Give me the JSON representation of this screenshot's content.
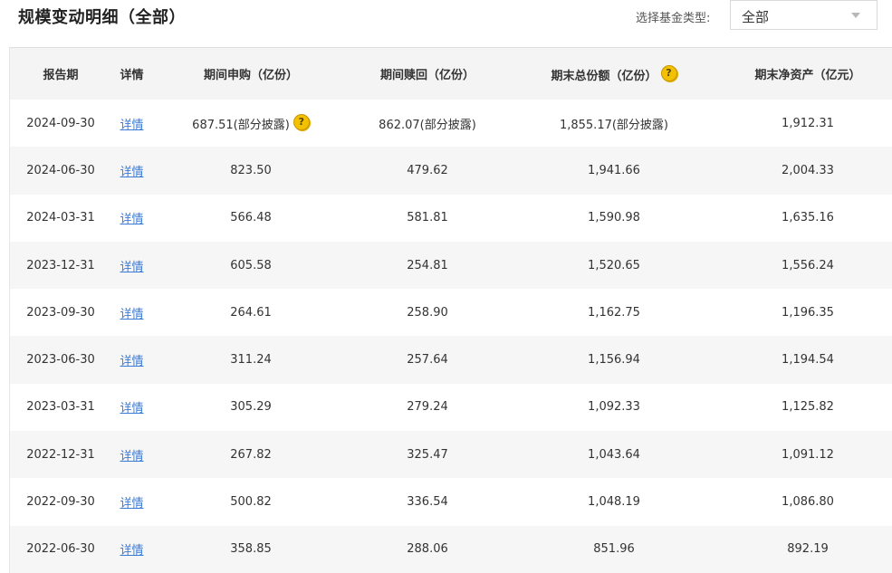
{
  "page": {
    "title": "规模变动明细（全部）"
  },
  "filter": {
    "label": "选择基金类型:",
    "selected": "全部"
  },
  "help_icon_glyph": "?",
  "table": {
    "headers": [
      "报告期",
      "详情",
      "期间申购（亿份）",
      "期间赎回（亿份）",
      "期末总份额（亿份）",
      "期末净资产（亿元）"
    ],
    "rows": [
      {
        "date": "2024-09-30",
        "detail": "详情",
        "purchase": "687.51(部分披露)",
        "redeem": "862.07(部分披露)",
        "total_shares": "1,855.17(部分披露)",
        "net_assets": "1,912.31"
      },
      {
        "date": "2024-06-30",
        "detail": "详情",
        "purchase": "823.50",
        "redeem": "479.62",
        "total_shares": "1,941.66",
        "net_assets": "2,004.33"
      },
      {
        "date": "2024-03-31",
        "detail": "详情",
        "purchase": "566.48",
        "redeem": "581.81",
        "total_shares": "1,590.98",
        "net_assets": "1,635.16"
      },
      {
        "date": "2023-12-31",
        "detail": "详情",
        "purchase": "605.58",
        "redeem": "254.81",
        "total_shares": "1,520.65",
        "net_assets": "1,556.24"
      },
      {
        "date": "2023-09-30",
        "detail": "详情",
        "purchase": "264.61",
        "redeem": "258.90",
        "total_shares": "1,162.75",
        "net_assets": "1,196.35"
      },
      {
        "date": "2023-06-30",
        "detail": "详情",
        "purchase": "311.24",
        "redeem": "257.64",
        "total_shares": "1,156.94",
        "net_assets": "1,194.54"
      },
      {
        "date": "2023-03-31",
        "detail": "详情",
        "purchase": "305.29",
        "redeem": "279.24",
        "total_shares": "1,092.33",
        "net_assets": "1,125.82"
      },
      {
        "date": "2022-12-31",
        "detail": "详情",
        "purchase": "267.82",
        "redeem": "325.47",
        "total_shares": "1,043.64",
        "net_assets": "1,091.12"
      },
      {
        "date": "2022-09-30",
        "detail": "详情",
        "purchase": "500.82",
        "redeem": "336.54",
        "total_shares": "1,048.19",
        "net_assets": "1,086.80"
      },
      {
        "date": "2022-06-30",
        "detail": "详情",
        "purchase": "358.85",
        "redeem": "288.06",
        "total_shares": "851.96",
        "net_assets": "892.19"
      }
    ]
  },
  "colors": {
    "link": "#3a7bd5",
    "header_bg": "#f4f4f4",
    "stripe_bg": "#f6f6f6",
    "help_icon": "#f2c200"
  }
}
